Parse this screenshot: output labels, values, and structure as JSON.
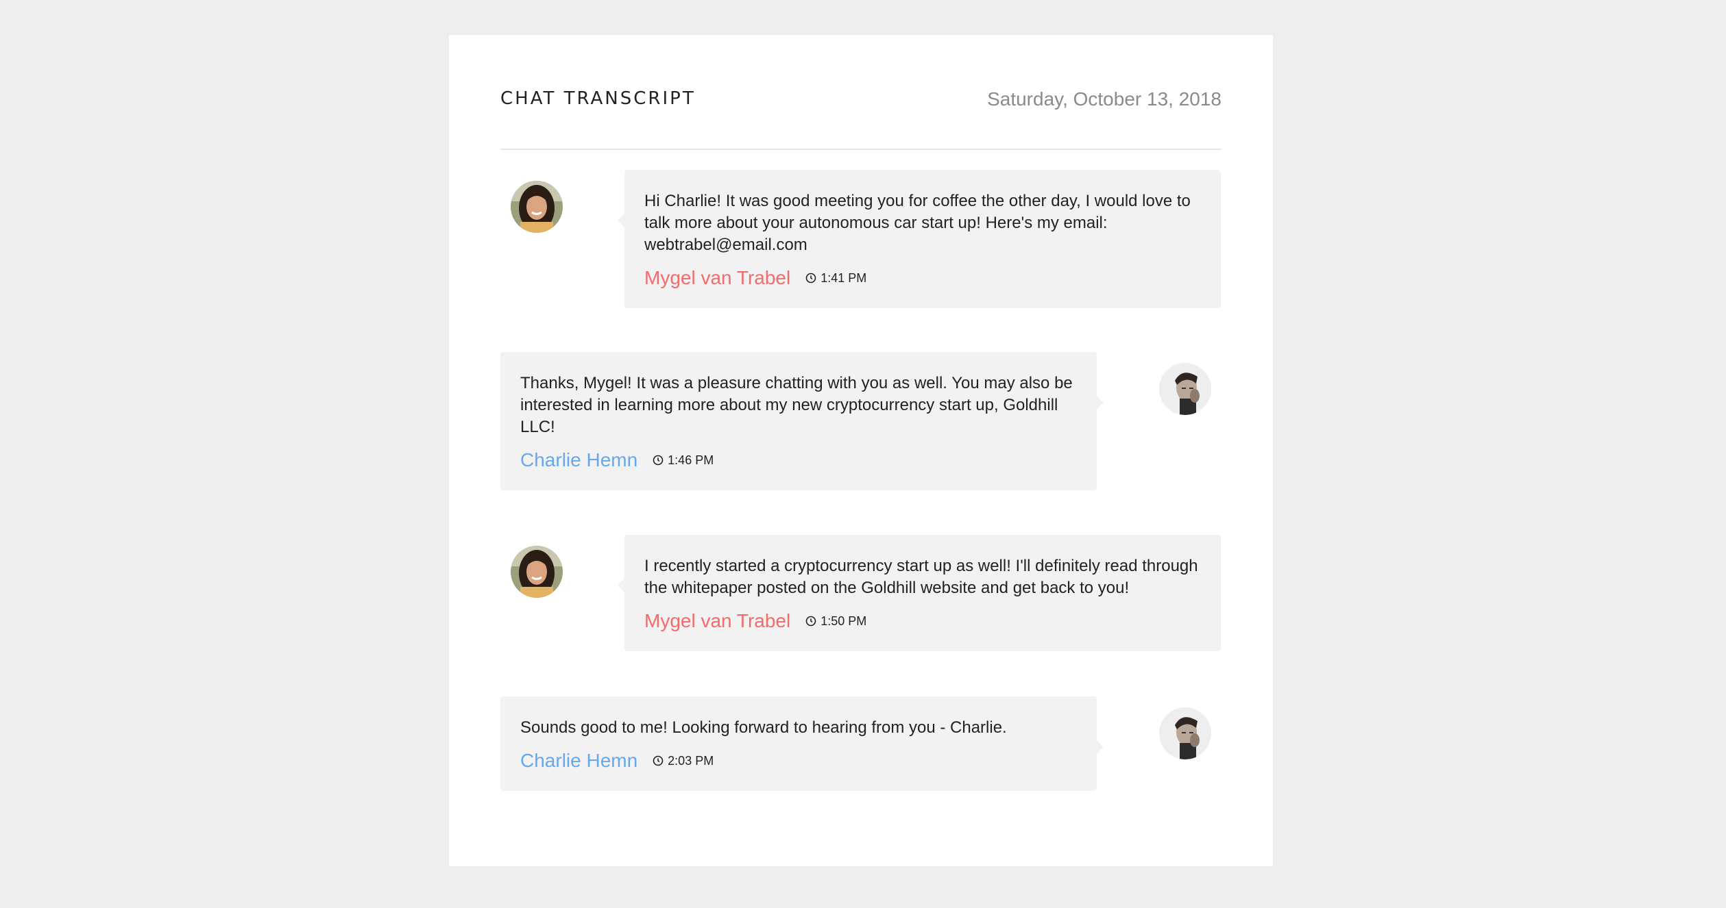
{
  "header": {
    "title": "CHAT TRANSCRIPT",
    "date": "Saturday, October 13, 2018"
  },
  "colors": {
    "mygel": "#f36b6b",
    "charlie": "#66a8ee",
    "bubble": "#f2f2f2"
  },
  "messages": [
    {
      "side": "left",
      "sender": "Mygel van Trabel",
      "avatar": "woman-avatar",
      "text": "Hi Charlie! It was good meeting you for coffee the other day, I would love to talk more about your autonomous car start up! Here's my email: webtrabel@email.com",
      "time": "1:41 PM"
    },
    {
      "side": "right",
      "sender": "Charlie Hemn",
      "avatar": "man-avatar",
      "text": "Thanks, Mygel! It was a pleasure chatting with you as well. You may also be interested in learning more about my new cryptocurrency start up, Goldhill LLC!",
      "time": "1:46 PM"
    },
    {
      "side": "left",
      "sender": "Mygel van Trabel",
      "avatar": "woman-avatar",
      "text": "I recently started a cryptocurrency start up as well! I'll definitely read through the whitepaper posted on the Goldhill website and get back to you!",
      "time": "1:50 PM"
    },
    {
      "side": "right",
      "sender": "Charlie Hemn",
      "avatar": "man-avatar",
      "text": "Sounds good to me! Looking forward to hearing from you - Charlie.",
      "time": "2:03 PM"
    }
  ]
}
